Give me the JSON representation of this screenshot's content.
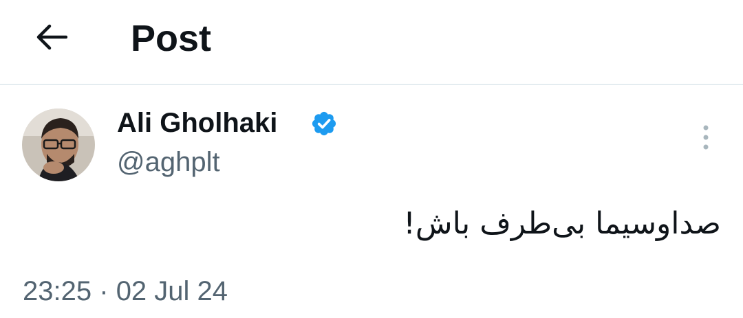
{
  "header": {
    "back_icon": "arrow-left-icon",
    "title": "Post"
  },
  "post": {
    "author": {
      "name": "Ali Gholhaki",
      "handle": "@aghplt",
      "verified": true,
      "verified_color": "#1d9bf0"
    },
    "text": "صداوسیما بی‌طرف باش!",
    "time": "23:25",
    "separator": "·",
    "date": "02 Jul 24",
    "more_icon": "more-vertical-icon"
  },
  "colors": {
    "primary_text": "#0f1419",
    "secondary_text": "#536471",
    "divider": "#e4ecf0"
  }
}
